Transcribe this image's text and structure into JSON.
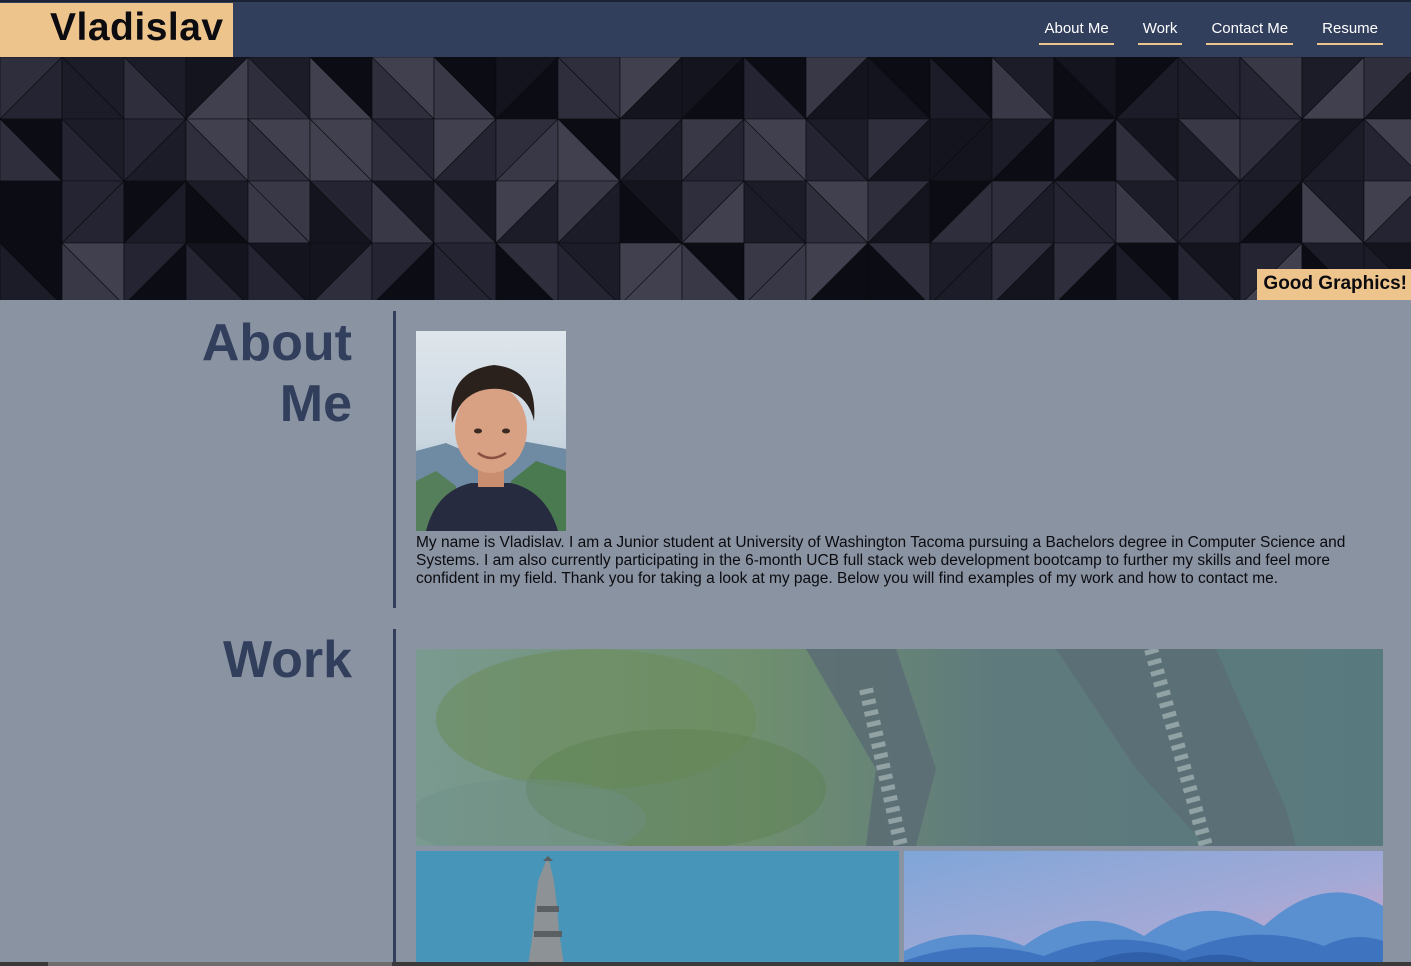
{
  "header": {
    "brand": "Vladislav",
    "nav": [
      "About Me",
      "Work",
      "Contact Me",
      "Resume"
    ]
  },
  "hero": {
    "badge": "Good Graphics!"
  },
  "about": {
    "title_line1": "About",
    "title_line2": "Me",
    "text": "My name is Vladislav. I am a Junior student at University of Washington Tacoma pursuing a Bachelors degree in Computer Science and Systems. I am also currently participating in the 6-month UCB full stack web development bootcamp to further my skills and feel more confident in my field. Thank you for taking a look at my page. Below you will find examples of my work and how to contact me."
  },
  "work": {
    "title": "Work"
  },
  "colors": {
    "header_bg": "#313e5c",
    "accent": "#eec48d",
    "page_bg": "#8a93a1",
    "title_text": "#313e5c"
  },
  "icons": {
    "hero": "geometric-triangle-pattern",
    "avatar": "profile-photo"
  }
}
